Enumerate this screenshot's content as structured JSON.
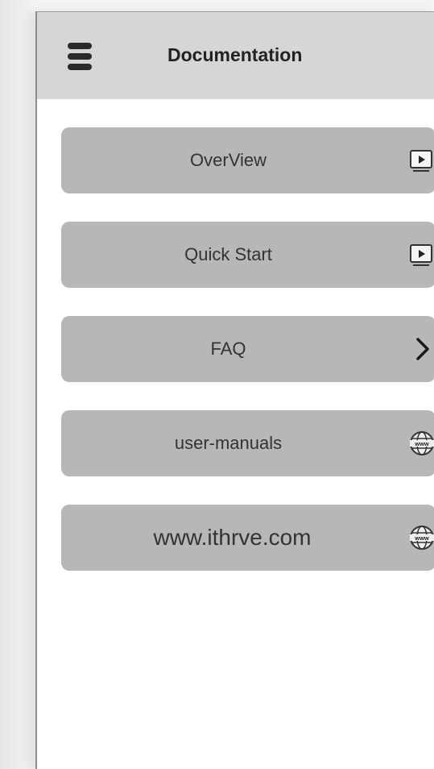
{
  "header": {
    "title": "Documentation",
    "menu_icon": "hamburger-menu-icon"
  },
  "menu_items": [
    {
      "label": "OverView",
      "icon": "play-video-icon"
    },
    {
      "label": "Quick Start",
      "icon": "play-video-icon"
    },
    {
      "label": "FAQ",
      "icon": "chevron-right-icon"
    },
    {
      "label": "user-manuals",
      "icon": "globe-www-icon"
    },
    {
      "label": "www.ithrve.com",
      "icon": "globe-www-icon"
    }
  ],
  "colors": {
    "header_bg": "#d6d6d6",
    "button_bg": "#b7b7b7",
    "page_bg": "#ffffff"
  }
}
